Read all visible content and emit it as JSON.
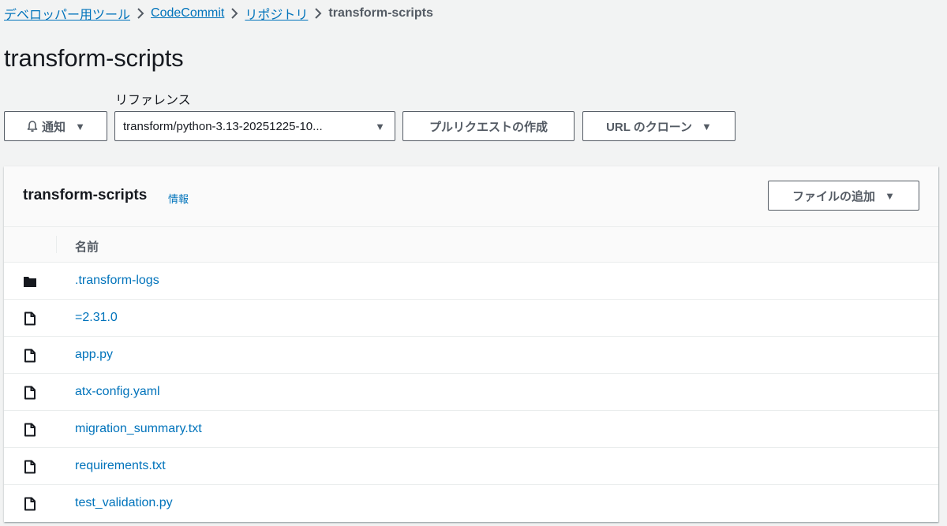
{
  "breadcrumb": {
    "items": [
      "デベロッパー用ツール",
      "CodeCommit",
      "リポジトリ"
    ],
    "current": "transform-scripts"
  },
  "page": {
    "title": "transform-scripts"
  },
  "toolbar": {
    "notify_label": "通知",
    "reference_label": "リファレンス",
    "reference_value": "transform/python-3.13-20251225-10...",
    "pull_request_label": "プルリクエストの作成",
    "clone_url_label": "URL のクローン"
  },
  "panel": {
    "title": "transform-scripts",
    "info_label": "情報",
    "add_file_label": "ファイルの追加",
    "column_name": "名前",
    "entries": [
      {
        "name": ".transform-logs",
        "type": "folder"
      },
      {
        "name": "=2.31.0",
        "type": "file"
      },
      {
        "name": "app.py",
        "type": "file"
      },
      {
        "name": "atx-config.yaml",
        "type": "file"
      },
      {
        "name": "migration_summary.txt",
        "type": "file"
      },
      {
        "name": "requirements.txt",
        "type": "file"
      },
      {
        "name": "test_validation.py",
        "type": "file"
      }
    ]
  },
  "colors": {
    "link": "#0073bb",
    "text": "#16191f",
    "secondary": "#545b64",
    "background": "#f2f3f3"
  },
  "icons": {
    "notify": "bell-icon",
    "folder": "folder-icon",
    "file": "file-icon",
    "dropdown": "caret-down-icon",
    "separator": "chevron-right-icon"
  }
}
